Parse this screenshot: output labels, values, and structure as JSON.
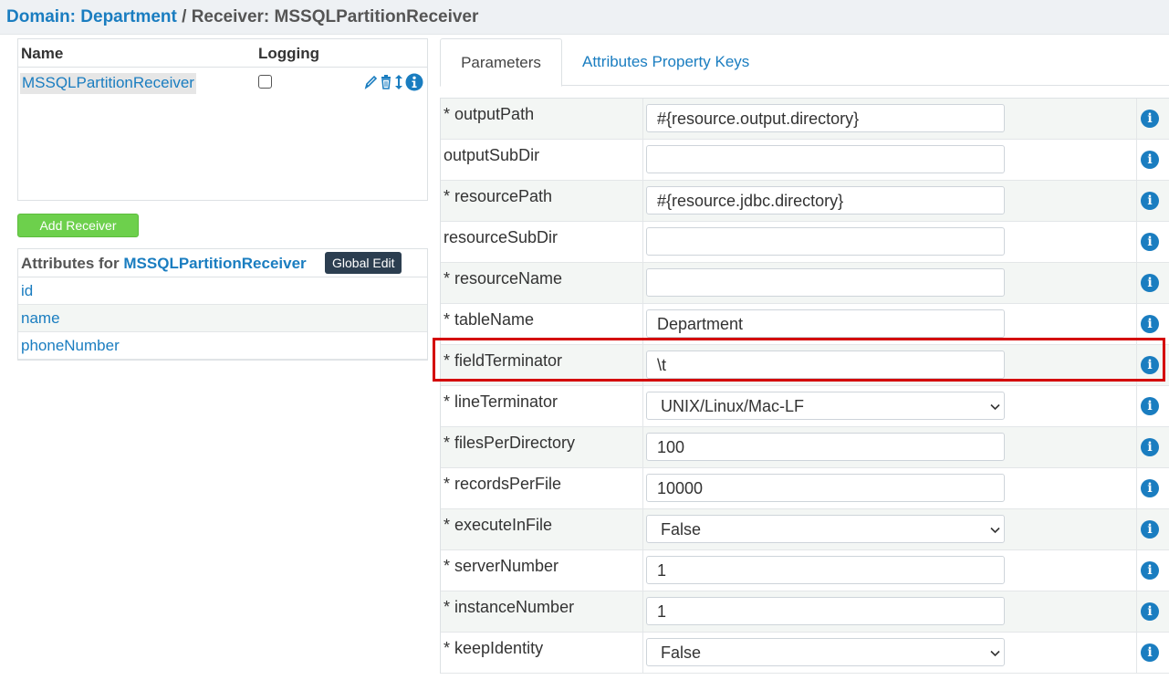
{
  "breadcrumb": {
    "domain": "Domain: Department",
    "separator": " / ",
    "receiver": "Receiver: MSSQLPartitionReceiver"
  },
  "receivers_table": {
    "headers": {
      "name": "Name",
      "logging": "Logging"
    },
    "rows": [
      {
        "name": "MSSQLPartitionReceiver",
        "logging": false
      }
    ],
    "icons": [
      "edit-icon",
      "trash-icon",
      "reorder-icon",
      "info-icon"
    ]
  },
  "add_receiver_label": "Add Receiver",
  "attributes": {
    "title_prefix": "Attributes for ",
    "receiver_name": "MSSQLPartitionReceiver",
    "global_edit_label": "Global Edit",
    "items": [
      "id",
      "name",
      "phoneNumber"
    ]
  },
  "tabs": [
    {
      "label": "Parameters",
      "active": true
    },
    {
      "label": "Attributes Property Keys",
      "active": false
    }
  ],
  "parameters": [
    {
      "label": "* outputPath",
      "value": "#{resource.output.directory}",
      "type": "text"
    },
    {
      "label": "outputSubDir",
      "value": "",
      "type": "text"
    },
    {
      "label": "* resourcePath",
      "value": "#{resource.jdbc.directory}",
      "type": "text"
    },
    {
      "label": "resourceSubDir",
      "value": "",
      "type": "text"
    },
    {
      "label": "* resourceName",
      "value": "",
      "type": "text"
    },
    {
      "label": "* tableName",
      "value": "Department",
      "type": "text"
    },
    {
      "label": "* fieldTerminator",
      "value": "\\t",
      "type": "text",
      "highlighted": true
    },
    {
      "label": "* lineTerminator",
      "value": "UNIX/Linux/Mac-LF",
      "type": "select"
    },
    {
      "label": "* filesPerDirectory",
      "value": "100",
      "type": "text"
    },
    {
      "label": "* recordsPerFile",
      "value": "10000",
      "type": "text"
    },
    {
      "label": "* executeInFile",
      "value": "False",
      "type": "select"
    },
    {
      "label": "* serverNumber",
      "value": "1",
      "type": "text"
    },
    {
      "label": "* instanceNumber",
      "value": "1",
      "type": "text"
    },
    {
      "label": "* keepIdentity",
      "value": "False",
      "type": "select"
    }
  ],
  "colors": {
    "link": "#1a7dc0",
    "add_button": "#6dd04c",
    "global_edit": "#2c3e50",
    "highlight": "#d40000"
  }
}
